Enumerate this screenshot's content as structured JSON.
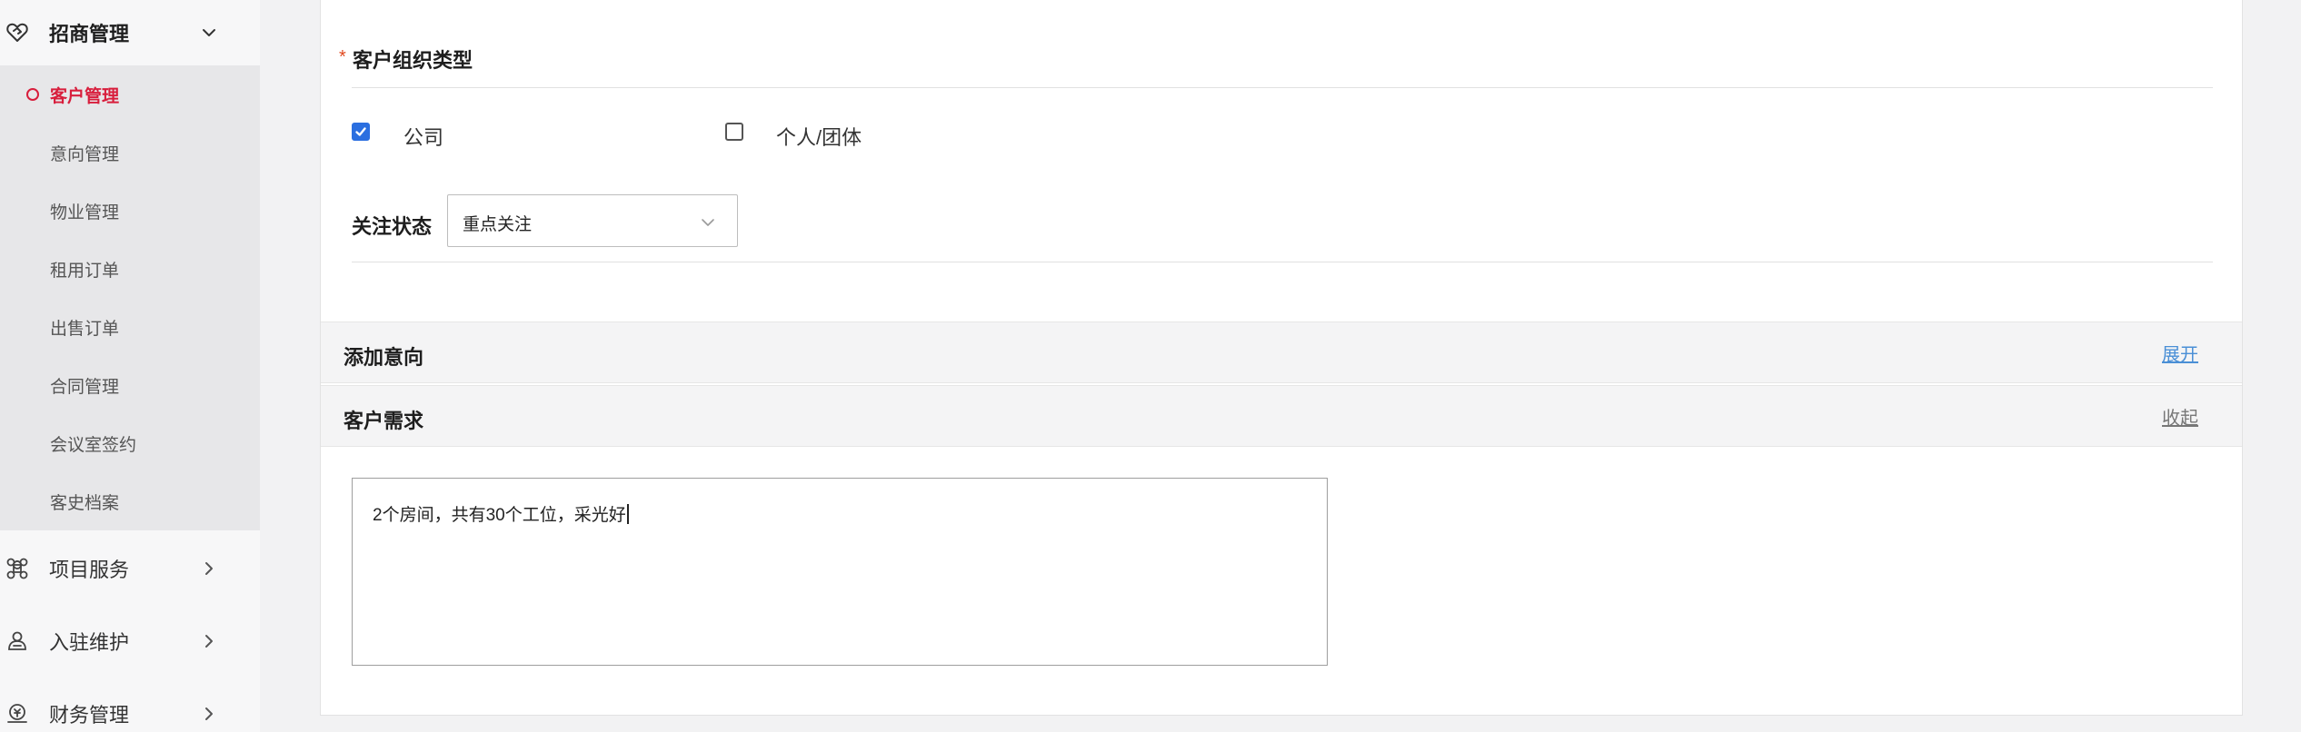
{
  "sidebar": {
    "group_active": {
      "label": "招商管理",
      "icon": "handshake-icon"
    },
    "sub_items": [
      {
        "label": "客户管理",
        "active": true
      },
      {
        "label": "意向管理"
      },
      {
        "label": "物业管理"
      },
      {
        "label": "租用订单"
      },
      {
        "label": "出售订单"
      },
      {
        "label": "合同管理"
      },
      {
        "label": "会议室签约"
      },
      {
        "label": "客史档案"
      }
    ],
    "groups": [
      {
        "label": "项目服务",
        "icon": "command-icon"
      },
      {
        "label": "入驻维护",
        "icon": "person-icon"
      },
      {
        "label": "财务管理",
        "icon": "finance-icon"
      }
    ]
  },
  "form": {
    "org_type": {
      "required_mark": "*",
      "title": "客户组织类型",
      "options": [
        {
          "label": "公司",
          "checked": true
        },
        {
          "label": "个人/团体",
          "checked": false
        }
      ]
    },
    "follow_status": {
      "label": "关注状态",
      "value": "重点关注"
    },
    "add_intent": {
      "title": "添加意向",
      "action": "展开"
    },
    "customer_needs": {
      "title": "客户需求",
      "action": "收起",
      "text": "2个房间，共有30个工位，采光好"
    }
  },
  "colors": {
    "accent_red": "#d81e3c",
    "checkbox_blue": "#2b6fe0",
    "link_blue": "#4a8fd6",
    "link_gray": "#777777"
  }
}
